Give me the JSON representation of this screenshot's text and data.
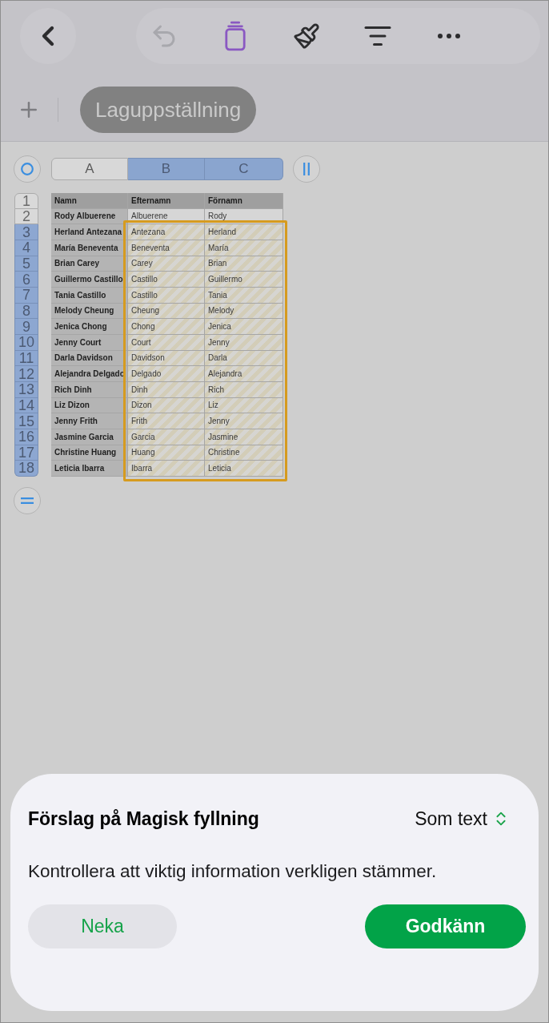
{
  "toolbar": {
    "undo": {
      "disabled": true
    },
    "tools": [
      {
        "kind": "table",
        "selected": true
      },
      {
        "kind": "brush",
        "selected": false
      },
      {
        "kind": "organize",
        "selected": false
      },
      {
        "kind": "more",
        "selected": false
      }
    ]
  },
  "sheet_tabs": [
    {
      "label": "Laguppställning",
      "selected": true
    }
  ],
  "table": {
    "columns": [
      {
        "label": "A",
        "selected": false
      },
      {
        "label": "B",
        "selected": true
      },
      {
        "label": "C",
        "selected": true
      }
    ],
    "rows": [
      {
        "number": "1",
        "kind": "header",
        "selected": false,
        "suggested": false,
        "cells": [
          "Namn",
          "Efternamn",
          "Förnamn"
        ]
      },
      {
        "number": "2",
        "kind": "data",
        "selected": false,
        "suggested": false,
        "cells": [
          "Rody Albuerene",
          "Albuerene",
          "Rody"
        ]
      },
      {
        "number": "3",
        "kind": "data",
        "selected": true,
        "suggested": true,
        "cells": [
          "Herland Antezana",
          "Antezana",
          "Herland"
        ]
      },
      {
        "number": "4",
        "kind": "data",
        "selected": true,
        "suggested": true,
        "cells": [
          "María Beneventa",
          "Beneventa",
          "María"
        ]
      },
      {
        "number": "5",
        "kind": "data",
        "selected": true,
        "suggested": true,
        "cells": [
          "Brian Carey",
          "Carey",
          "Brian"
        ]
      },
      {
        "number": "6",
        "kind": "data",
        "selected": true,
        "suggested": true,
        "cells": [
          "Guillermo Castillo",
          "Castillo",
          "Guillermo"
        ]
      },
      {
        "number": "7",
        "kind": "data",
        "selected": true,
        "suggested": true,
        "cells": [
          "Tania Castillo",
          "Castillo",
          "Tania"
        ]
      },
      {
        "number": "8",
        "kind": "data",
        "selected": true,
        "suggested": true,
        "cells": [
          "Melody Cheung",
          "Cheung",
          "Melody"
        ]
      },
      {
        "number": "9",
        "kind": "data",
        "selected": true,
        "suggested": true,
        "cells": [
          "Jenica Chong",
          "Chong",
          "Jenica"
        ]
      },
      {
        "number": "10",
        "kind": "data",
        "selected": true,
        "suggested": true,
        "cells": [
          "Jenny Court",
          "Court",
          "Jenny"
        ]
      },
      {
        "number": "11",
        "kind": "data",
        "selected": true,
        "suggested": true,
        "cells": [
          "Darla Davidson",
          "Davidson",
          "Darla"
        ]
      },
      {
        "number": "12",
        "kind": "data",
        "selected": true,
        "suggested": true,
        "cells": [
          "Alejandra Delgado",
          "Delgado",
          "Alejandra"
        ]
      },
      {
        "number": "13",
        "kind": "data",
        "selected": true,
        "suggested": true,
        "cells": [
          "Rich Dinh",
          "Dinh",
          "Rich"
        ]
      },
      {
        "number": "14",
        "kind": "data",
        "selected": true,
        "suggested": true,
        "cells": [
          "Liz Dizon",
          "Dizon",
          "Liz"
        ]
      },
      {
        "number": "15",
        "kind": "data",
        "selected": true,
        "suggested": true,
        "cells": [
          "Jenny Frith",
          "Frith",
          "Jenny"
        ]
      },
      {
        "number": "16",
        "kind": "data",
        "selected": true,
        "suggested": true,
        "cells": [
          "Jasmine Garcia",
          "Garcia",
          "Jasmine"
        ]
      },
      {
        "number": "17",
        "kind": "data",
        "selected": true,
        "suggested": true,
        "cells": [
          "Christine Huang",
          "Huang",
          "Christine"
        ]
      },
      {
        "number": "18",
        "kind": "data",
        "selected": true,
        "suggested": true,
        "cells": [
          "Leticia Ibarra",
          "Ibarra",
          "Leticia"
        ]
      }
    ]
  },
  "magic_fill_sheet": {
    "title": "Förslag på Magisk fyllning",
    "format_picker": {
      "value": "Som text"
    },
    "message": "Kontrollera att viktig information verkligen stämmer.",
    "buttons": [
      {
        "label": "Neka",
        "kind": "secondary"
      },
      {
        "label": "Godkänn",
        "kind": "primary"
      }
    ]
  }
}
